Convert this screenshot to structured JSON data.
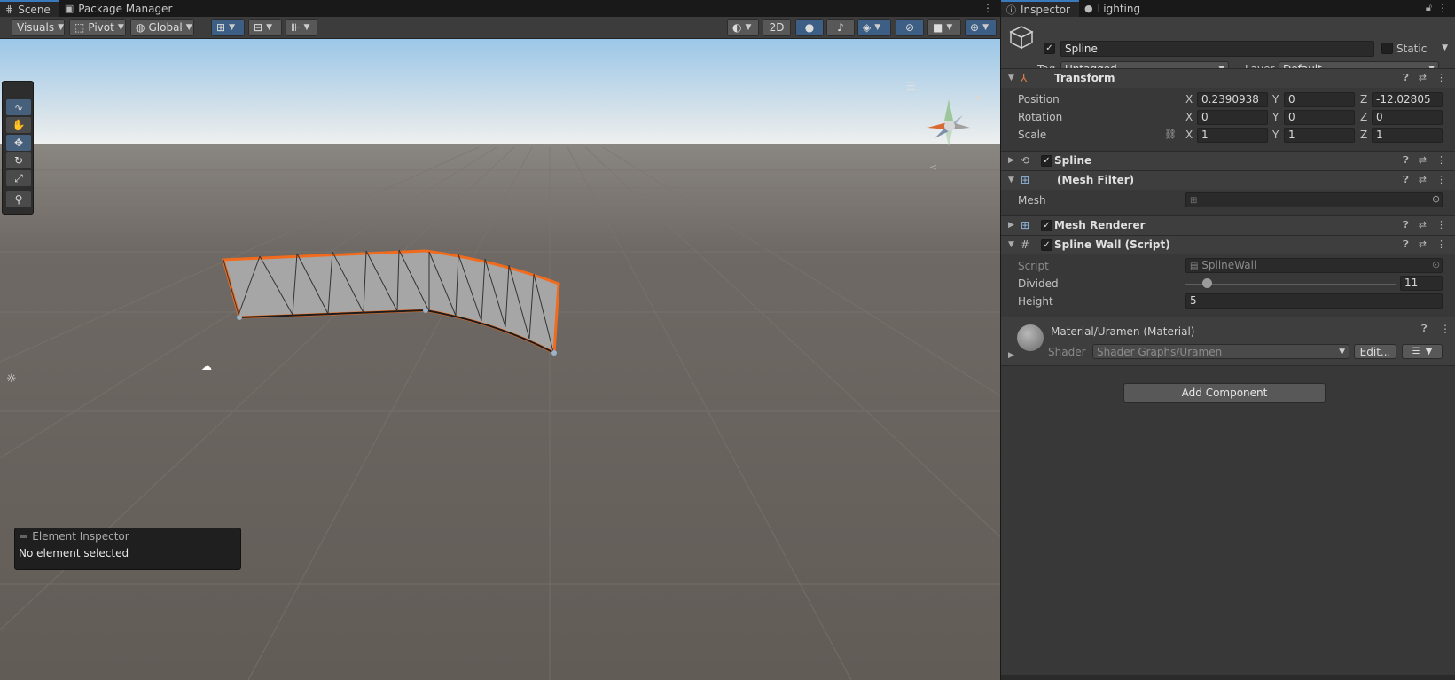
{
  "scene_panel": {
    "tabs": [
      {
        "label": "Scene",
        "icon": "hash-icon"
      },
      {
        "label": "Package Manager",
        "icon": "package-icon"
      }
    ],
    "toolbar": {
      "visuals": "Visuals",
      "pivot": "Pivot",
      "global": "Global",
      "mode_2d": "2D"
    },
    "tools": [
      "spline-tool",
      "hand-tool",
      "move-tool",
      "rotate-tool",
      "scale-tool",
      "custom-tool"
    ],
    "element_inspector": {
      "title": "Element Inspector",
      "message": "No element selected"
    },
    "accent_color": "#f26b1d"
  },
  "inspector": {
    "tabs": [
      {
        "label": "Inspector",
        "icon": "info-icon"
      },
      {
        "label": "Lighting",
        "icon": "bulb-icon"
      }
    ],
    "object": {
      "name": "Spline",
      "active": true,
      "static_label": "Static",
      "tag_label": "Tag",
      "tag_value": "Untagged",
      "layer_label": "Layer",
      "layer_value": "Default"
    },
    "transform": {
      "title": "Transform",
      "position_label": "Position",
      "rotation_label": "Rotation",
      "scale_label": "Scale",
      "position": {
        "x": "0.2390938",
        "y": "0",
        "z": "-12.02805"
      },
      "rotation": {
        "x": "0",
        "y": "0",
        "z": "0"
      },
      "scale": {
        "x": "1",
        "y": "1",
        "z": "1"
      }
    },
    "spline": {
      "title": "Spline",
      "enabled": true
    },
    "mesh_filter": {
      "title": "(Mesh Filter)",
      "mesh_label": "Mesh",
      "mesh_value": ""
    },
    "mesh_renderer": {
      "title": "Mesh Renderer",
      "enabled": true
    },
    "spline_wall": {
      "title": "Spline Wall (Script)",
      "script_label": "Script",
      "script_value": "SplineWall",
      "divided_label": "Divided",
      "divided_value": "11",
      "divided_fraction": 0.1,
      "height_label": "Height",
      "height_value": "5"
    },
    "material": {
      "title": "Material/Uramen (Material)",
      "shader_label": "Shader",
      "shader_value": "Shader Graphs/Uramen",
      "edit_label": "Edit..."
    },
    "add_component": "Add Component"
  }
}
